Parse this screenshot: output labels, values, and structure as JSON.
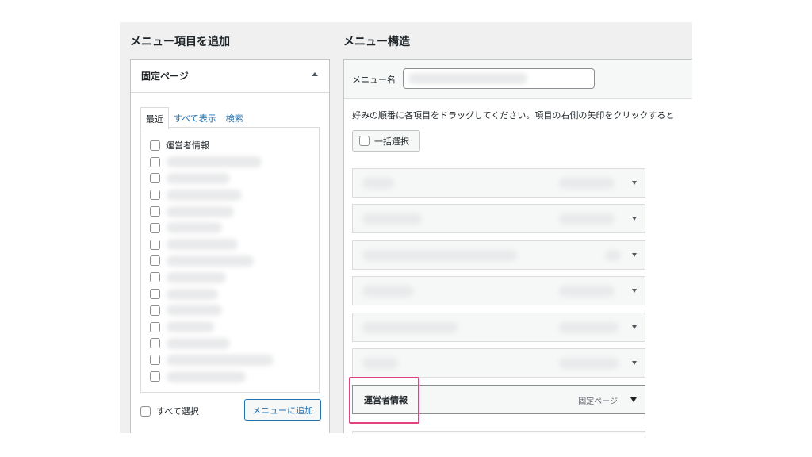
{
  "add_items": {
    "heading": "メニュー項目を追加",
    "accordion_title": "固定ページ",
    "tabs": [
      {
        "label": "最近",
        "active": true
      },
      {
        "label": "すべて表示",
        "active": false
      },
      {
        "label": "検索",
        "active": false
      }
    ],
    "pages": [
      {
        "label": "運営者情報"
      },
      {
        "label": ""
      },
      {
        "label": ""
      },
      {
        "label": ""
      },
      {
        "label": ""
      },
      {
        "label": ""
      },
      {
        "label": ""
      },
      {
        "label": ""
      },
      {
        "label": ""
      },
      {
        "label": ""
      },
      {
        "label": ""
      },
      {
        "label": ""
      },
      {
        "label": ""
      },
      {
        "label": ""
      },
      {
        "label": ""
      }
    ],
    "select_all_label": "すべて選択",
    "add_button_label": "メニューに追加"
  },
  "menu_structure": {
    "heading": "メニュー構造",
    "menu_name_label": "メニュー名",
    "menu_name_value": "",
    "instructions": "好みの順番に各項目をドラッグしてください。項目の右側の矢印をクリックすると",
    "bulk_select_label": "一括選択",
    "items": [
      {
        "title": "",
        "type": ""
      },
      {
        "title": "",
        "type": ""
      },
      {
        "title": "",
        "type": ""
      },
      {
        "title": "",
        "type": ""
      },
      {
        "title": "",
        "type": ""
      },
      {
        "title": "",
        "type": ""
      },
      {
        "title": "運営者情報",
        "type": "固定ページ"
      }
    ]
  },
  "colors": {
    "link": "#2271b1",
    "highlight": "#e0437e",
    "panel_border": "#c3c4c7"
  }
}
